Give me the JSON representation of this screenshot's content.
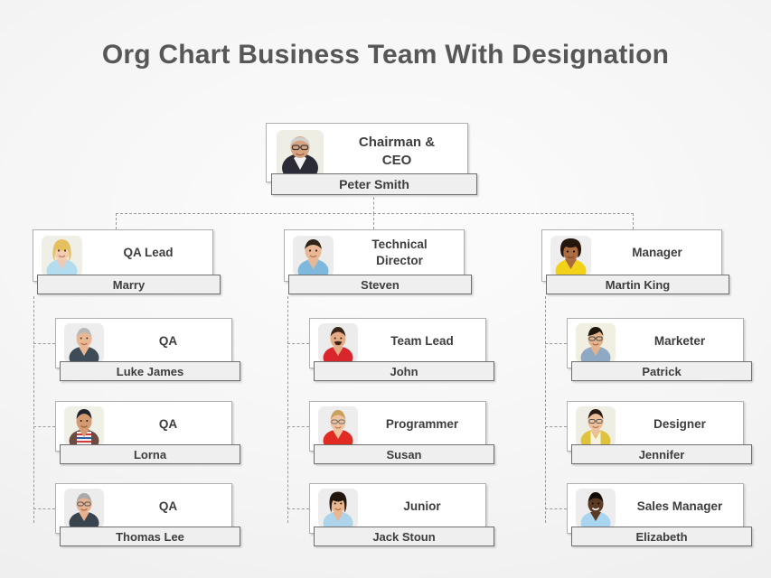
{
  "title": "Org Chart Business  Team With Designation",
  "theme": {
    "background_start": "#fcfcfc",
    "background_end": "#e9e9e9",
    "title_color": "#575757",
    "card_background": "#ffffff",
    "card_border": "#b0b0b0",
    "namebar_background": "#efefef",
    "namebar_border": "#6e6e6e",
    "text_color": "#3d3d3d",
    "connector_color": "#9a9a9a"
  },
  "nodes": {
    "ceo": {
      "role": "Chairman  &\nCEO",
      "role_line1": "Chairman  &",
      "role_line2": "CEO",
      "name": "Peter Smith",
      "photo": "portrait-man-bald-glasses-suit"
    },
    "qa_lead": {
      "role_line1": "QA Lead",
      "role_line2": "",
      "name": "Marry",
      "photo": "portrait-woman-blonde-blue-top"
    },
    "technical_director": {
      "role_line1": "Technical",
      "role_line2": "Director",
      "name": "Steven",
      "photo": "portrait-man-dark-hair-blue-shirt"
    },
    "manager": {
      "role_line1": "Manager",
      "role_line2": "",
      "name": "Martin King",
      "photo": "portrait-woman-curly-hair-yellow-top"
    },
    "qa_1": {
      "role_line1": "QA",
      "name": "Luke James",
      "photo": "portrait-man-gray-hair-teal-shirt"
    },
    "qa_2": {
      "role_line1": "QA",
      "name": "Lorna",
      "photo": "portrait-man-dark-hair-striped-shirt"
    },
    "qa_3": {
      "role_line1": "QA",
      "name": "Thomas Lee",
      "photo": "portrait-man-glasses-navy-shirt"
    },
    "team_lead": {
      "role_line1": "Team Lead",
      "name": "John",
      "photo": "portrait-man-beard-red-polo"
    },
    "programmer": {
      "role_line1": "Programmer",
      "name": "Susan",
      "photo": "portrait-man-glasses-red-shirt"
    },
    "junior": {
      "role_line1": "Junior",
      "name": "Jack Stoun",
      "photo": "portrait-woman-dark-hair-blue-top"
    },
    "marketer": {
      "role_line1": "Marketer",
      "name": "Patrick",
      "photo": "portrait-woman-short-hair-denim-shirt"
    },
    "designer": {
      "role_line1": "Designer",
      "name": "Jennifer",
      "photo": "portrait-woman-glasses-yellow-cardigan"
    },
    "sales_manager": {
      "role_line1": "Sales Manager",
      "name": "Elizabeth",
      "photo": "portrait-man-dark-skin-lightblue-tshirt"
    }
  }
}
